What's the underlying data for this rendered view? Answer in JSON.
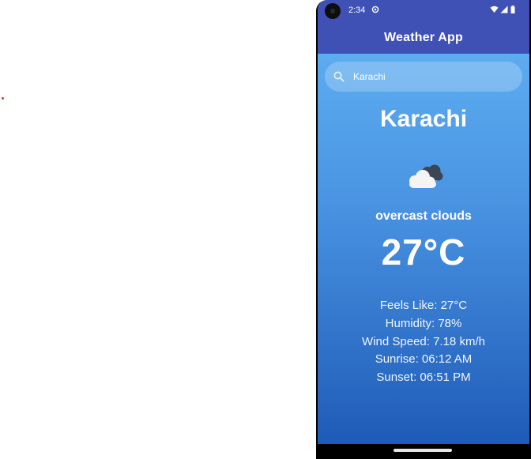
{
  "status_bar": {
    "time": "2:34",
    "icons": [
      "camera-icon",
      "notification-icon",
      "wifi-icon",
      "signal-icon",
      "battery-icon"
    ]
  },
  "app_bar": {
    "title": "Weather App"
  },
  "search": {
    "value": "Karachi",
    "icon": "search-icon"
  },
  "weather": {
    "city": "Karachi",
    "icon": "overcast-clouds-icon",
    "condition": "overcast clouds",
    "temperature": "27°C",
    "details": [
      "Feels Like: 27°C",
      "Humidity: 78%",
      "Wind Speed: 7.18 km/h",
      "Sunrise: 06:12 AM",
      "Sunset: 06:51 PM"
    ]
  },
  "colors": {
    "app_bar": "#3f51b5",
    "gradient_top": "#63b5f6",
    "gradient_bottom": "#1e5bb8",
    "text": "#ffffff"
  }
}
